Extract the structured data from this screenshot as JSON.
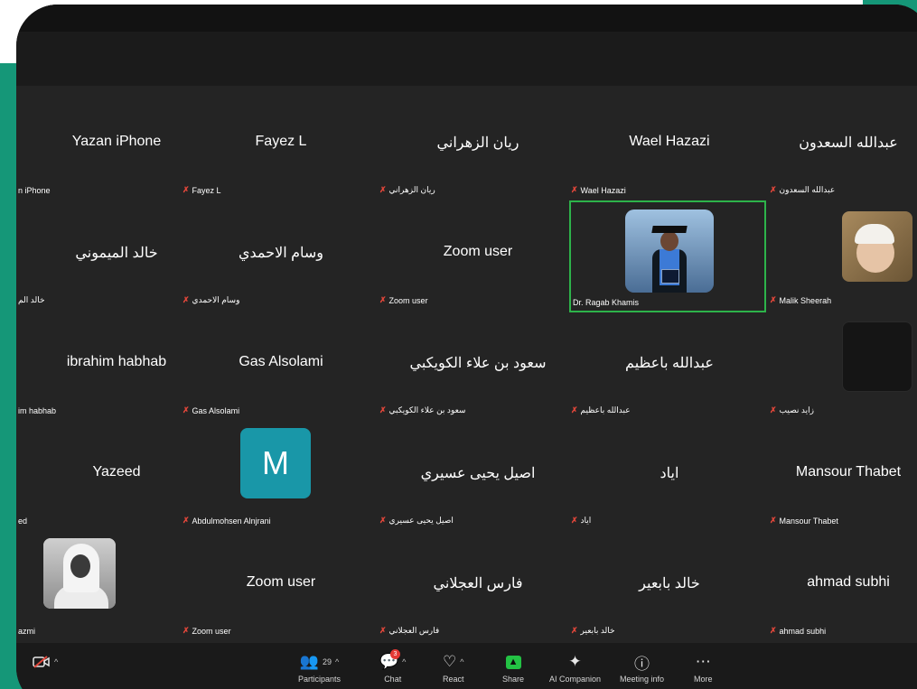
{
  "tiles": [
    {
      "name": "Yazan iPhone",
      "tag": "n iPhone"
    },
    {
      "name": "Fayez L",
      "tag": "Fayez L"
    },
    {
      "name": "ريان الزهراني",
      "tag": "ريان الزهراني"
    },
    {
      "name": "Wael Hazazi",
      "tag": "Wael Hazazi"
    },
    {
      "name": "عبدالله السعدون",
      "tag": "عبدالله السعدون"
    },
    {
      "name": "خالد الميموني",
      "tag": "خالد الم"
    },
    {
      "name": "وسام الاحمدي",
      "tag": "وسام الاحمدي"
    },
    {
      "name": "Zoom user",
      "tag": "Zoom user"
    },
    {
      "name": "",
      "tag": "Dr. Ragab Khamis"
    },
    {
      "name": "",
      "tag": "Malik Sheerah"
    },
    {
      "name": "ibrahim habhab",
      "tag": "im habhab"
    },
    {
      "name": "Gas Alsolami",
      "tag": "Gas Alsolami"
    },
    {
      "name": "سعود بن علاء الكويكبي",
      "tag": "سعود بن علاء الكويكبي"
    },
    {
      "name": "عبدالله باعظيم",
      "tag": "عبدالله باعظيم"
    },
    {
      "name": "",
      "tag": "زايد نصيب"
    },
    {
      "name": "Yazeed",
      "tag": "ed"
    },
    {
      "name": "",
      "tag": "Abdulmohsen Alnjrani",
      "avatar": "M"
    },
    {
      "name": "اصيل يحيى عسيري",
      "tag": "اصيل يحيى عسيري"
    },
    {
      "name": "اياد",
      "tag": "اياد"
    },
    {
      "name": "Mansour Thabet",
      "tag": "Mansour Thabet"
    },
    {
      "name": "",
      "tag": "azmi"
    },
    {
      "name": "Zoom user",
      "tag": "Zoom user"
    },
    {
      "name": "فارس العجلاني",
      "tag": "فارس العجلاني"
    },
    {
      "name": "خالد بابعير",
      "tag": "خالد بابعير"
    },
    {
      "name": "ahmad subhi",
      "tag": "ahmad subhi"
    }
  ],
  "toolbar": {
    "participants_label": "Participants",
    "participants_count": "29",
    "chat_label": "Chat",
    "chat_badge": "3",
    "react_label": "React",
    "share_label": "Share",
    "ai_label": "AI Companion",
    "info_label": "Meeting info",
    "more_label": "More"
  },
  "colors": {
    "accent_teal": "#159778",
    "active_border": "#2db34a",
    "share_green": "#23c244",
    "muted_red": "#e0463a"
  }
}
